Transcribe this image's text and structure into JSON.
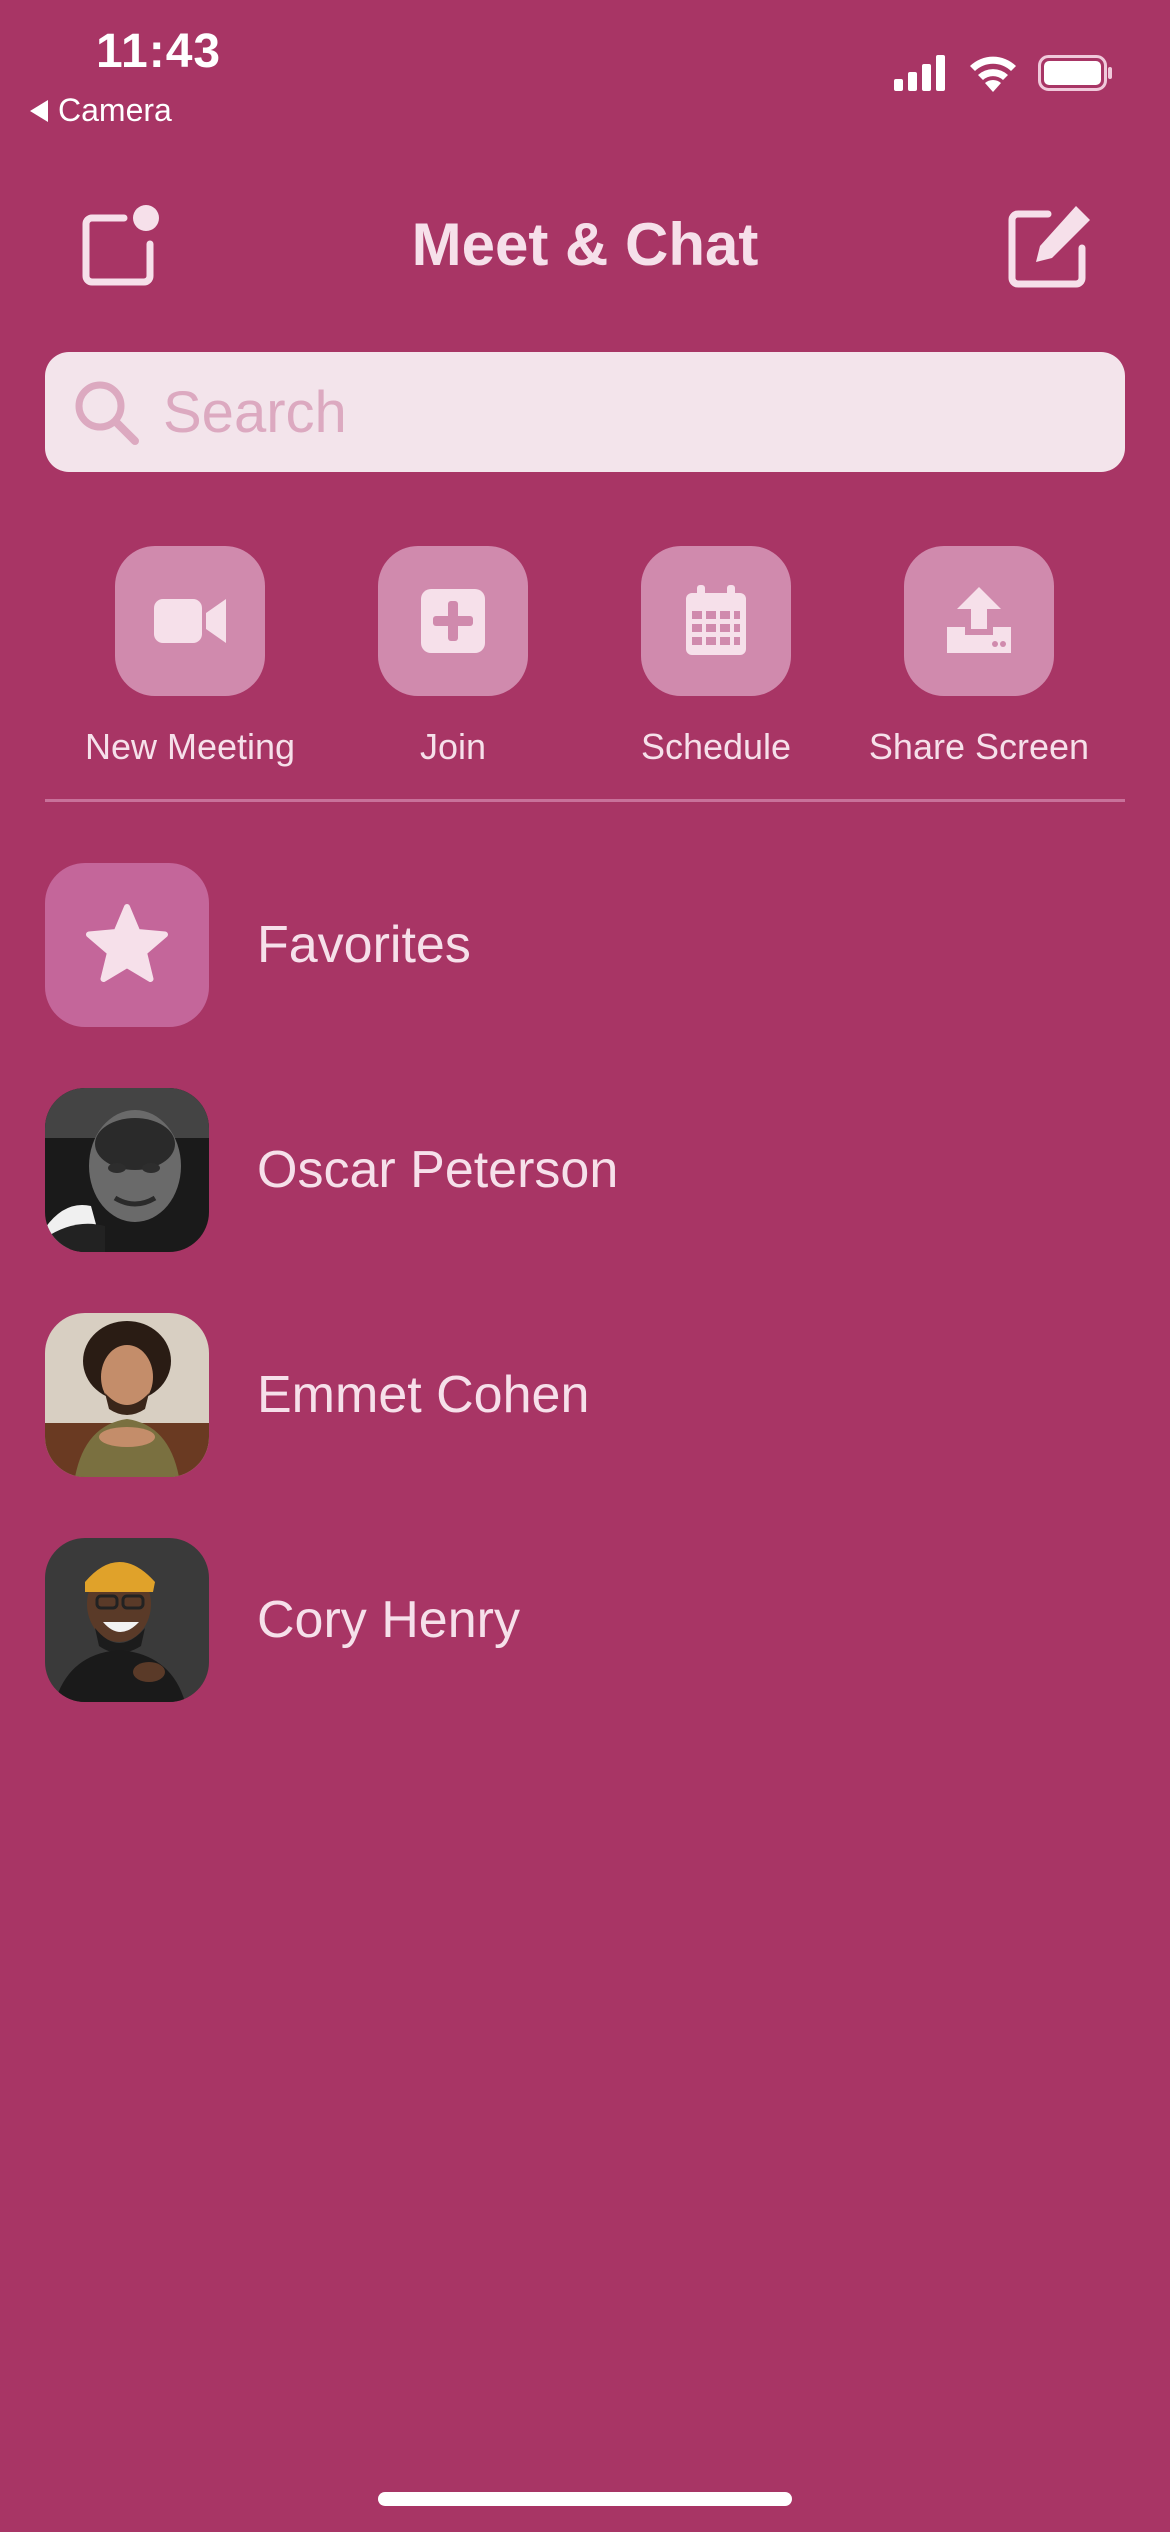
{
  "status_bar": {
    "time": "11:43",
    "back_app": "Camera"
  },
  "header": {
    "title": "Meet & Chat",
    "left_icon": "new-window-notification-icon",
    "right_icon": "compose-icon"
  },
  "search": {
    "placeholder": "Search",
    "value": ""
  },
  "actions": [
    {
      "label": "New Meeting",
      "icon": "video-camera-icon"
    },
    {
      "label": "Join",
      "icon": "plus-square-icon"
    },
    {
      "label": "Schedule",
      "icon": "calendar-icon"
    },
    {
      "label": "Share Screen",
      "icon": "upload-icon"
    }
  ],
  "list": [
    {
      "label": "Favorites",
      "icon": "star-icon"
    },
    {
      "label": "Oscar Peterson",
      "icon": "avatar"
    },
    {
      "label": "Emmet Cohen",
      "icon": "avatar"
    },
    {
      "label": "Cory Henry",
      "icon": "avatar"
    }
  ],
  "colors": {
    "background": "#a83565",
    "tile": "#d08aad",
    "search_bg": "#f3e4eb",
    "text": "#f6e0ea"
  }
}
